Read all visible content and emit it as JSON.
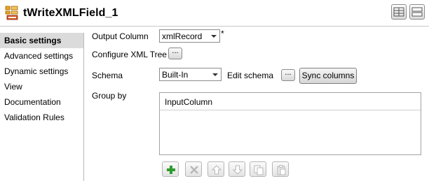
{
  "header": {
    "title": "tWriteXMLField_1",
    "icon": "component-icon"
  },
  "sidebar": {
    "items": [
      {
        "label": "Basic settings",
        "active": true
      },
      {
        "label": "Advanced settings"
      },
      {
        "label": "Dynamic settings"
      },
      {
        "label": "View"
      },
      {
        "label": "Documentation"
      },
      {
        "label": "Validation Rules"
      }
    ]
  },
  "form": {
    "output_column_label": "Output Column",
    "output_column_value": "xmlRecord",
    "required_marker": "*",
    "configure_xml_tree_label": "Configure XML Tree",
    "ellipsis": "...",
    "schema_label": "Schema",
    "schema_value": "Built-In",
    "edit_schema_label": "Edit schema",
    "sync_columns_label": "Sync columns",
    "group_by_label": "Group by",
    "table_columns": [
      "InputColumn"
    ]
  },
  "toolbar": {
    "icons": [
      "add-icon",
      "delete-icon",
      "move-up-icon",
      "move-down-icon",
      "copy-icon",
      "paste-icon"
    ]
  },
  "colors": {
    "active_nav_bg": "#dbdbdb",
    "add_green": "#2e9b2e"
  }
}
